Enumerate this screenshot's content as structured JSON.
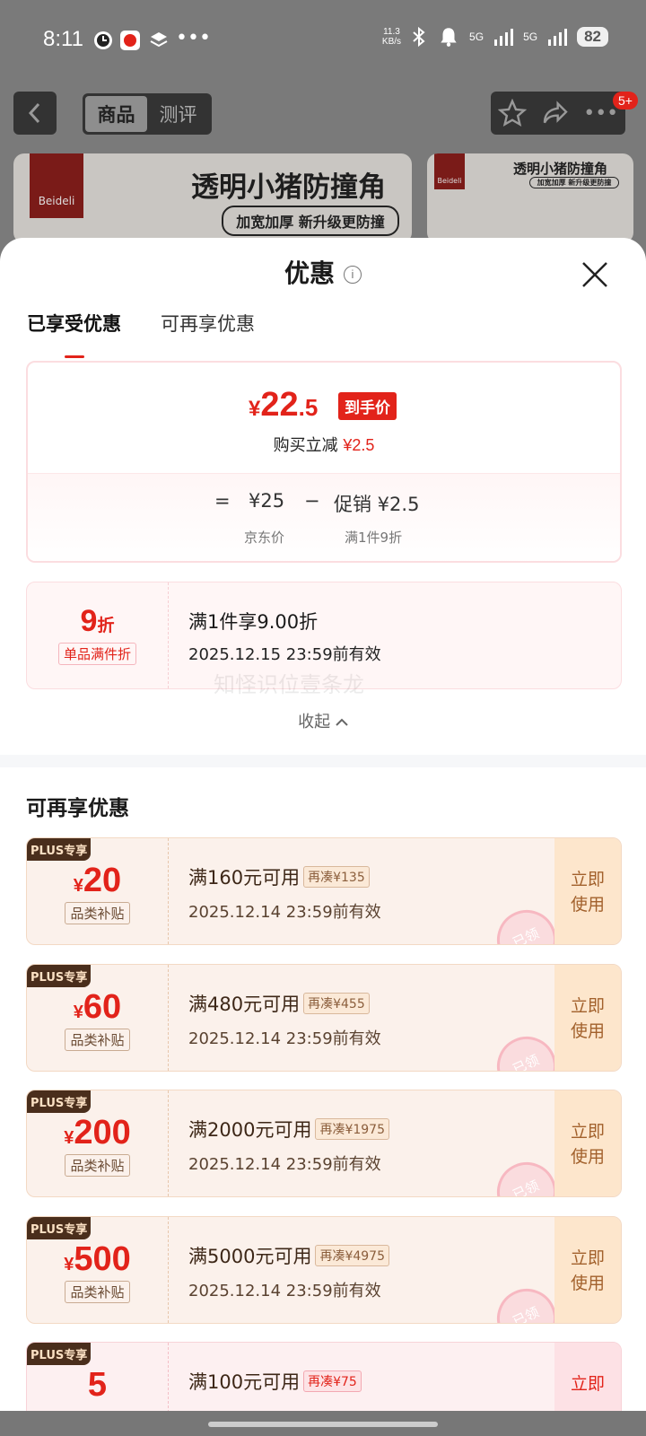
{
  "status": {
    "time": "8:11",
    "speed_top": "11.3",
    "speed_bot": "KB/s",
    "net1": "5G",
    "net2": "5G",
    "battery": "82"
  },
  "nav": {
    "tab_product": "商品",
    "tab_review": "测评",
    "badge": "5+"
  },
  "banner": {
    "brand": "Beideli",
    "title": "透明小猪防撞角",
    "subtitle": "加宽加厚 新升级更防撞"
  },
  "sheet": {
    "title": "优惠",
    "tab_enjoyed": "已享受优惠",
    "tab_more": "可再享优惠",
    "info": "i"
  },
  "price": {
    "currency": "¥",
    "int": "22",
    "dec": ".5",
    "tag": "到手价",
    "reduce_label": "购买立减",
    "reduce_value": "¥2.5",
    "eq": "=",
    "jd_price": "¥25",
    "minus": "−",
    "promo": "促销 ¥2.5",
    "jd_label": "京东价",
    "promo_label": "满1件9折"
  },
  "discount": {
    "num": "9",
    "unit": "折",
    "tag": "单品满件折",
    "title": "满1件享9.00折",
    "valid": "2025.12.15 23:59前有效"
  },
  "watermark": "知怪识位壹条龙",
  "collapse": "收起",
  "more_title": "可再享优惠",
  "coupons": [
    {
      "plus": "PLUS专享",
      "cur": "¥",
      "amount": "20",
      "type": "品类补贴",
      "title": "满160元可用",
      "tag": "再凑¥135",
      "valid": "2025.12.14 23:59前有效",
      "action1": "立即",
      "action2": "使用",
      "stamp": "已领"
    },
    {
      "plus": "PLUS专享",
      "cur": "¥",
      "amount": "60",
      "type": "品类补贴",
      "title": "满480元可用",
      "tag": "再凑¥455",
      "valid": "2025.12.14 23:59前有效",
      "action1": "立即",
      "action2": "使用",
      "stamp": "已领"
    },
    {
      "plus": "PLUS专享",
      "cur": "¥",
      "amount": "200",
      "type": "品类补贴",
      "title": "满2000元可用",
      "tag": "再凑¥1975",
      "valid": "2025.12.14 23:59前有效",
      "action1": "立即",
      "action2": "使用",
      "stamp": "已领"
    },
    {
      "plus": "PLUS专享",
      "cur": "¥",
      "amount": "500",
      "type": "品类补贴",
      "title": "满5000元可用",
      "tag": "再凑¥4975",
      "valid": "2025.12.14 23:59前有效",
      "action1": "立即",
      "action2": "使用",
      "stamp": "已领"
    },
    {
      "plus": "PLUS专享",
      "cur": "",
      "amount": "5",
      "type": "",
      "title": "满100元可用",
      "tag": "再凑¥75",
      "valid": "",
      "action1": "立即",
      "action2": "",
      "stamp": ""
    }
  ],
  "colors": {
    "accent": "#e2231a",
    "coupon_bg": "#fbf1eb",
    "action_bg": "#fde6cc"
  }
}
